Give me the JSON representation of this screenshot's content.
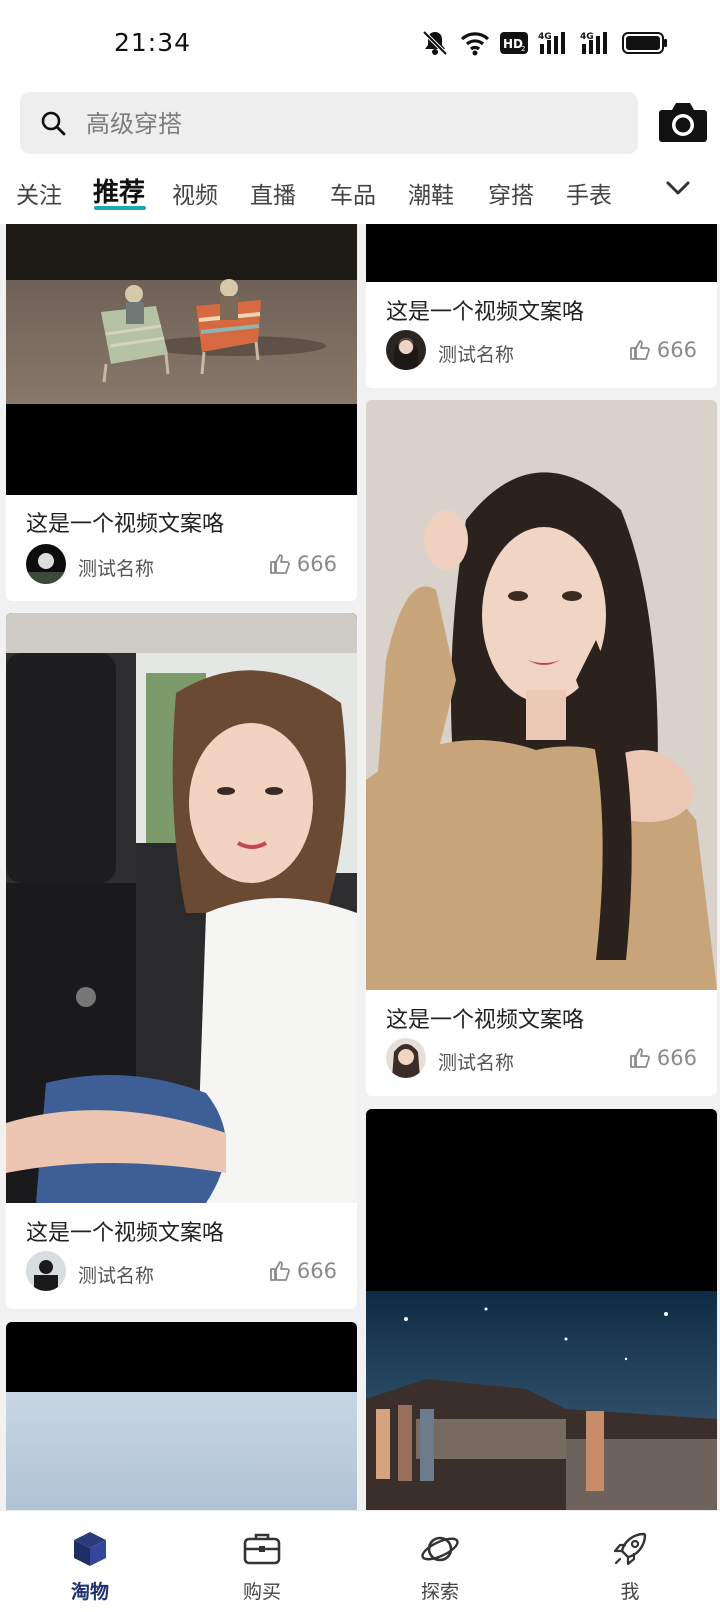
{
  "status_bar": {
    "time": "21:34",
    "icons": [
      "mute-bell-icon",
      "wifi-icon",
      "hd-icon",
      "signal-4g-icon",
      "signal-4g-icon",
      "battery-icon"
    ]
  },
  "search": {
    "placeholder": "高级穿搭",
    "icon": "search-icon",
    "camera_icon": "camera-icon"
  },
  "tabs": {
    "items": [
      "关注",
      "推荐",
      "视频",
      "直播",
      "车品",
      "潮鞋",
      "穿搭",
      "手表"
    ],
    "active": "推荐",
    "accent": "#1ba9b8",
    "more_icon": "chevron-down-icon"
  },
  "feed": {
    "cards": [
      {
        "caption": "这是一个视频文案咯",
        "author": "测试名称",
        "likes": "666"
      },
      {
        "caption": "这是一个视频文案咯",
        "author": "测试名称",
        "likes": "666"
      },
      {
        "caption": "这是一个视频文案咯",
        "author": "测试名称",
        "likes": "666"
      },
      {
        "caption": "这是一个视频文案咯",
        "author": "测试名称",
        "likes": "666"
      },
      {
        "caption": "",
        "author": "",
        "likes": ""
      },
      {
        "caption": "",
        "author": "",
        "likes": ""
      }
    ]
  },
  "bottom_nav": {
    "items": [
      {
        "label": "淘物",
        "icon": "cube-icon",
        "active": true
      },
      {
        "label": "购买",
        "icon": "briefcase-icon",
        "active": false
      },
      {
        "label": "探索",
        "icon": "planet-icon",
        "active": false
      },
      {
        "label": "我",
        "icon": "rocket-icon",
        "active": false
      }
    ],
    "active_color": "#1e3070"
  }
}
